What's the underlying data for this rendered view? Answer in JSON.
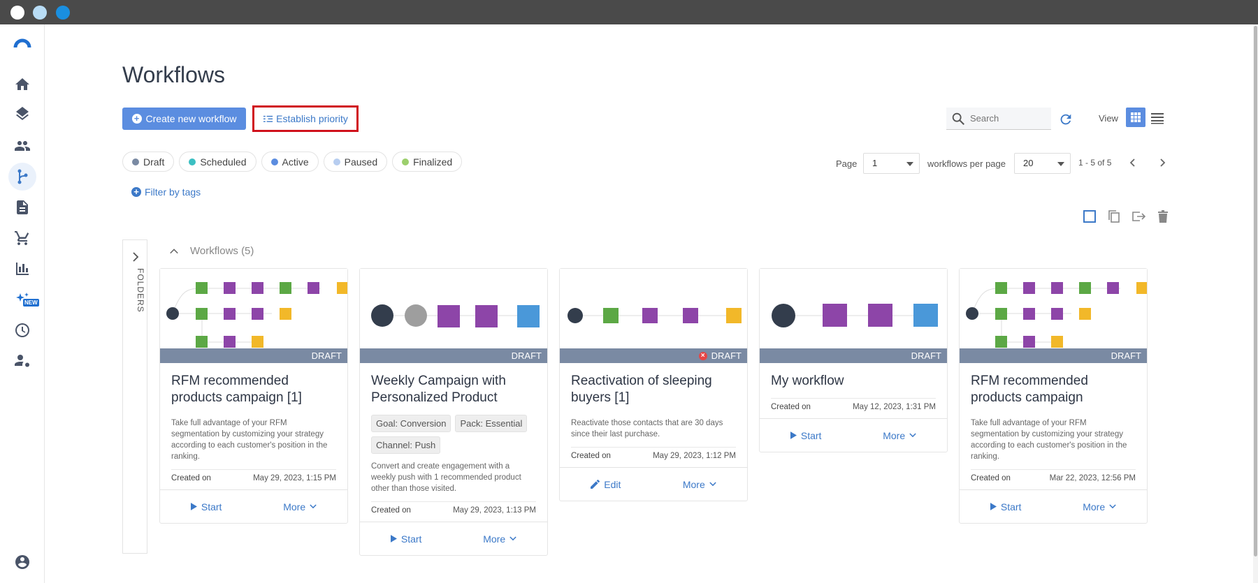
{
  "window": {
    "controls": [
      "close",
      "minimize",
      "maximize"
    ]
  },
  "sidebar": {
    "items": [
      {
        "name": "home-icon"
      },
      {
        "name": "layers-icon"
      },
      {
        "name": "contacts-icon"
      },
      {
        "name": "workflow-icon",
        "active": true
      },
      {
        "name": "document-icon"
      },
      {
        "name": "cart-icon"
      },
      {
        "name": "chart-icon"
      },
      {
        "name": "ai-sparkle-icon",
        "badge": "NEW"
      },
      {
        "name": "dashboard-icon"
      },
      {
        "name": "user-settings-icon"
      },
      {
        "name": "account-icon"
      }
    ]
  },
  "page": {
    "title": "Workflows"
  },
  "toolbar": {
    "create_label": "Create new workflow",
    "priority_label": "Establish priority",
    "search_placeholder": "Search",
    "view_label": "View"
  },
  "filters": [
    {
      "label": "Draft",
      "color": "#7a8aa3"
    },
    {
      "label": "Scheduled",
      "color": "#3bbfc2"
    },
    {
      "label": "Active",
      "color": "#5b8de0"
    },
    {
      "label": "Paused",
      "color": "#b7cdf0"
    },
    {
      "label": "Finalized",
      "color": "#9ccf6c"
    }
  ],
  "filter_tags_label": "Filter by tags",
  "pagination": {
    "page_label": "Page",
    "page_value": "1",
    "per_page_label": "workflows per page",
    "per_page_value": "20",
    "range": "1 - 5 of 5"
  },
  "folders_label": "FOLDERS",
  "group": {
    "title": "Workflows (5)"
  },
  "cards": [
    {
      "status": "DRAFT",
      "error": false,
      "title": "RFM recommended products campaign [1]",
      "tags": [],
      "description": "Take full advantage of your RFM segmentation by customizing your strategy according to each customer's position in the ranking.",
      "created_label": "Created on",
      "created_date": "May 29, 2023, 1:15 PM",
      "primary_action": "Start",
      "more_label": "More"
    },
    {
      "status": "DRAFT",
      "error": false,
      "title": "Weekly Campaign with Personalized Product",
      "tags": [
        "Goal: Conversion",
        "Pack: Essential",
        "Channel: Push"
      ],
      "description": "Convert and create engagement with a weekly push with 1 recommended product other than those visited.",
      "created_label": "Created on",
      "created_date": "May 29, 2023, 1:13 PM",
      "primary_action": "Start",
      "more_label": "More"
    },
    {
      "status": "DRAFT",
      "error": true,
      "title": "Reactivation of sleeping buyers [1]",
      "tags": [],
      "description": "Reactivate those contacts that are 30 days since their last purchase.",
      "created_label": "Created on",
      "created_date": "May 29, 2023, 1:12 PM",
      "primary_action": "Edit",
      "more_label": "More"
    },
    {
      "status": "DRAFT",
      "error": false,
      "title": "My workflow",
      "tags": [],
      "description": "",
      "created_label": "Created on",
      "created_date": "May 12, 2023, 1:31 PM",
      "primary_action": "Start",
      "more_label": "More"
    },
    {
      "status": "DRAFT",
      "error": false,
      "title": "RFM recommended products campaign",
      "tags": [],
      "description": "Take full advantage of your RFM segmentation by customizing your strategy according to each customer's position in the ranking.",
      "created_label": "Created on",
      "created_date": "Mar 22, 2023, 12:56 PM",
      "primary_action": "Start",
      "more_label": "More"
    }
  ],
  "colors": {
    "accent": "#5b8de0",
    "link": "#3c79c8",
    "highlight_border": "#d0121c",
    "draft_bar": "#7a8aa3",
    "node_green": "#5ca845",
    "node_purple": "#8d45a8",
    "node_yellow": "#f2b829",
    "node_blue": "#4a98d9"
  }
}
